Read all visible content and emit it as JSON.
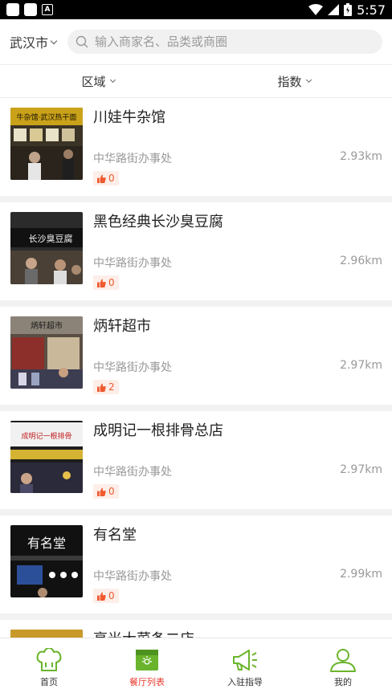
{
  "status_bar": {
    "time": "5:57"
  },
  "header": {
    "city": "武汉市",
    "search_placeholder": "输入商家名、品类或商圈"
  },
  "filters": {
    "area": "区域",
    "index": "指数"
  },
  "restaurants": [
    {
      "name": "川娃牛杂馆",
      "address": "中华路街办事处",
      "distance": "2.93km",
      "likes": "0"
    },
    {
      "name": "黑色经典长沙臭豆腐",
      "address": "中华路街办事处",
      "distance": "2.96km",
      "likes": "0"
    },
    {
      "name": "炳轩超市",
      "address": "中华路街办事处",
      "distance": "2.97km",
      "likes": "2"
    },
    {
      "name": "成明记一根排骨总店",
      "address": "中华路街办事处",
      "distance": "2.97km",
      "likes": "0"
    },
    {
      "name": "有名堂",
      "address": "中华路街办事处",
      "distance": "2.99km",
      "likes": "0"
    },
    {
      "name": "亭光大菜条二店",
      "address": "",
      "distance": "",
      "likes": ""
    }
  ],
  "thumb_texts": {
    "t0": "牛杂馆·武汉热干面",
    "t1": "长沙臭豆腐",
    "t2": "炳轩超市",
    "t3": "成明记一根排骨",
    "t4": "有名堂"
  },
  "tabbar": {
    "home": "首页",
    "restaurants": "餐厅列表",
    "guide": "入驻指导",
    "mine": "我的"
  },
  "colors": {
    "accent_green": "#6ab42d",
    "active_red": "#e8382c",
    "like_orange": "#ef5a2f"
  }
}
